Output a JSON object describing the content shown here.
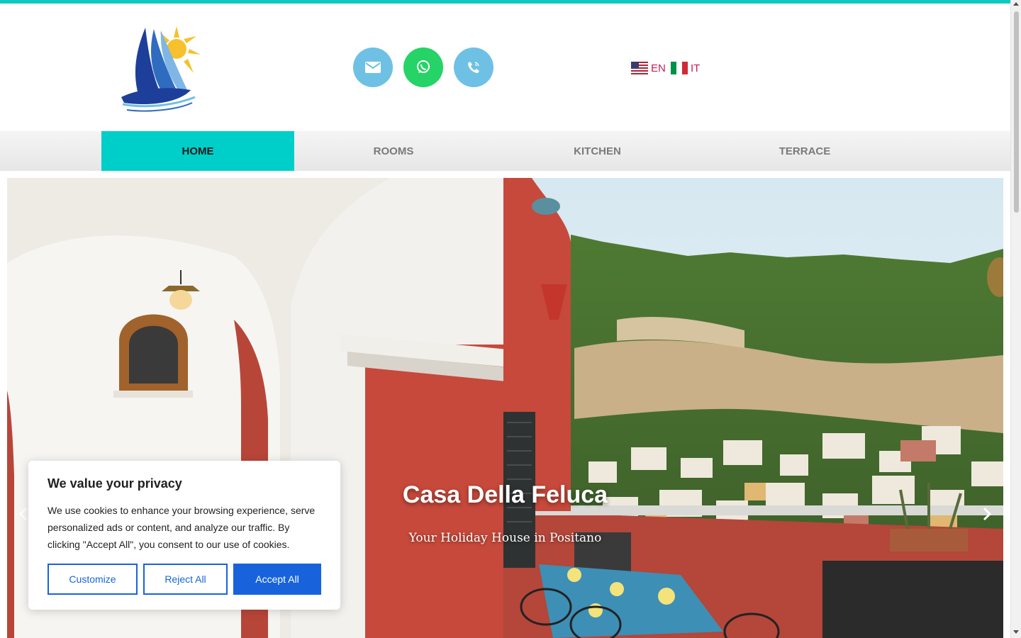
{
  "header": {
    "logo_alt": "Casa della Feluca",
    "contact": {
      "email_icon": "envelope-icon",
      "whatsapp_icon": "whatsapp-icon",
      "phone_icon": "phone-icon"
    },
    "languages": [
      {
        "code": "EN",
        "flag": "us-flag-icon"
      },
      {
        "code": "IT",
        "flag": "italy-flag-icon"
      }
    ]
  },
  "nav": {
    "items": [
      {
        "label": "HOME",
        "active": true
      },
      {
        "label": "ROOMS",
        "active": false
      },
      {
        "label": "KITCHEN",
        "active": false
      },
      {
        "label": "TERRACE",
        "active": false
      }
    ]
  },
  "hero": {
    "title": "Casa Della Feluca",
    "subtitle": "Your Holiday House in Positano"
  },
  "cookie_banner": {
    "title": "We value your privacy",
    "text": "We use cookies to enhance your browsing experience, serve personalized ads or content, and analyze our traffic. By clicking \"Accept All\", you consent to our use of cookies.",
    "customize_label": "Customize",
    "reject_label": "Reject All",
    "accept_label": "Accept All"
  },
  "colors": {
    "accent": "#00cec9",
    "whatsapp": "#25d366",
    "contact": "#6ec1e4",
    "cookie_primary": "#1863dc",
    "lang": "#c41e56"
  }
}
